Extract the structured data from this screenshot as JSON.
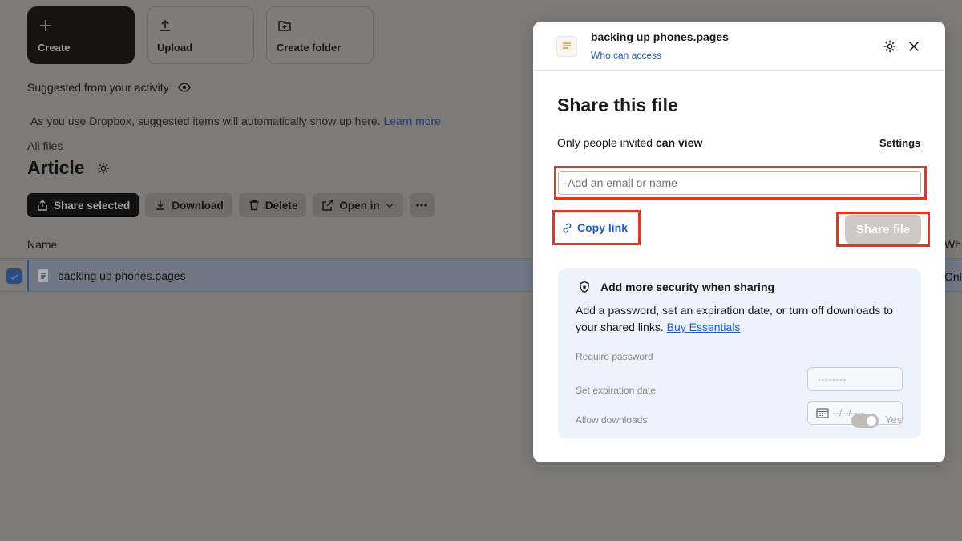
{
  "actions": {
    "create": "Create",
    "upload": "Upload",
    "create_folder": "Create folder"
  },
  "suggested": {
    "heading": "Suggested from your activity",
    "message": "As you use Dropbox, suggested items will automatically show up here.",
    "learn_more": "Learn more"
  },
  "breadcrumb": "All files",
  "folder": {
    "title": "Article"
  },
  "toolbar": {
    "share_selected": "Share selected",
    "download": "Download",
    "delete": "Delete",
    "open_in": "Open in"
  },
  "table": {
    "name_header": "Name",
    "who_header": "Wh",
    "rows": [
      {
        "name": "backing up phones.pages",
        "who": "Onl",
        "selected": true
      }
    ]
  },
  "modal": {
    "file_name": "backing up phones.pages",
    "who_can_access": "Who can access",
    "title": "Share this file",
    "permission_prefix": "Only people invited",
    "permission_level": "can view",
    "settings": "Settings",
    "email_placeholder": "Add an email or name",
    "copy_link": "Copy link",
    "share_file": "Share file",
    "security": {
      "title": "Add more security when sharing",
      "desc": "Add a password, set an expiration date, or turn off downloads to your shared links.",
      "buy": "Buy Essentials",
      "require_password": "Require password",
      "password_placeholder": "--------",
      "set_expiration": "Set expiration date",
      "date_placeholder": "--/--/----",
      "allow_downloads": "Allow downloads",
      "allow_downloads_value": "Yes"
    }
  },
  "colors": {
    "highlight": "#e8331f",
    "link": "#1e5fc2",
    "security_bg": "#edf3fc"
  },
  "icons": [
    "plus-icon",
    "upload-icon",
    "folder-plus-icon",
    "eye-icon",
    "gear-icon",
    "share-icon",
    "download-icon",
    "trash-icon",
    "open-external-icon",
    "chevron-down-icon",
    "more-icon",
    "check-icon",
    "pages-file-icon",
    "close-icon",
    "link-icon",
    "shield-icon",
    "calendar-icon"
  ]
}
